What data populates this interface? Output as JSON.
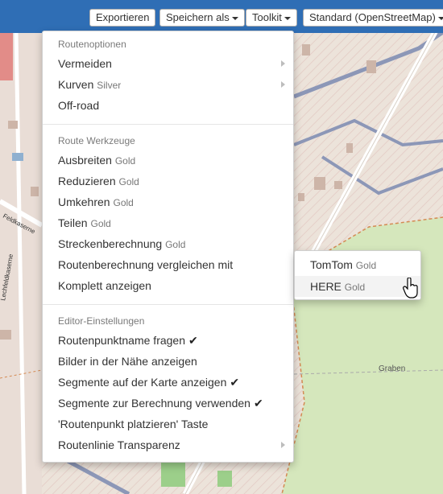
{
  "toolbar": {
    "export_label": "Exportieren",
    "save_as_label": "Speichern als",
    "toolkit_label": "Toolkit",
    "map_style_label": "Standard (OpenStreetMap)"
  },
  "map": {
    "labels": {
      "street_1": "Feldkaserne",
      "street_2": "Lechfeldkaserne",
      "graben": "Graben"
    }
  },
  "menu": {
    "sections": [
      {
        "header": "Routenoptionen",
        "items": [
          {
            "label": "Vermeiden",
            "tag": "",
            "submenu": true
          },
          {
            "label": "Kurven",
            "tag": "Silver",
            "submenu": true
          },
          {
            "label": "Off-road",
            "tag": ""
          }
        ]
      },
      {
        "header": "Route Werkzeuge",
        "items": [
          {
            "label": "Ausbreiten",
            "tag": "Gold"
          },
          {
            "label": "Reduzieren",
            "tag": "Gold"
          },
          {
            "label": "Umkehren",
            "tag": "Gold"
          },
          {
            "label": "Teilen",
            "tag": "Gold"
          },
          {
            "label": "Streckenberechnung",
            "tag": "Gold"
          },
          {
            "label": "Routenberechnung vergleichen mit",
            "tag": ""
          },
          {
            "label": "Komplett anzeigen",
            "tag": ""
          }
        ]
      },
      {
        "header": "Editor-Einstellungen",
        "items": [
          {
            "label": "Routenpunktname fragen",
            "checked": true,
            "check": "✔"
          },
          {
            "label": "Bilder in der Nähe anzeigen",
            "checked": false
          },
          {
            "label": "Segmente auf der Karte anzeigen",
            "checked": true,
            "check": "✔"
          },
          {
            "label": "Segmente zur Berechnung verwenden",
            "checked": true,
            "check": "✔"
          },
          {
            "label": "'Routenpunkt platzieren' Taste",
            "checked": false
          },
          {
            "label": "Routenlinie Transparenz",
            "submenu": true
          }
        ]
      }
    ]
  },
  "submenu": {
    "items": [
      {
        "label": "TomTom",
        "tag": "Gold",
        "hovered": false
      },
      {
        "label": "HERE",
        "tag": "Gold",
        "hovered": true
      }
    ]
  }
}
